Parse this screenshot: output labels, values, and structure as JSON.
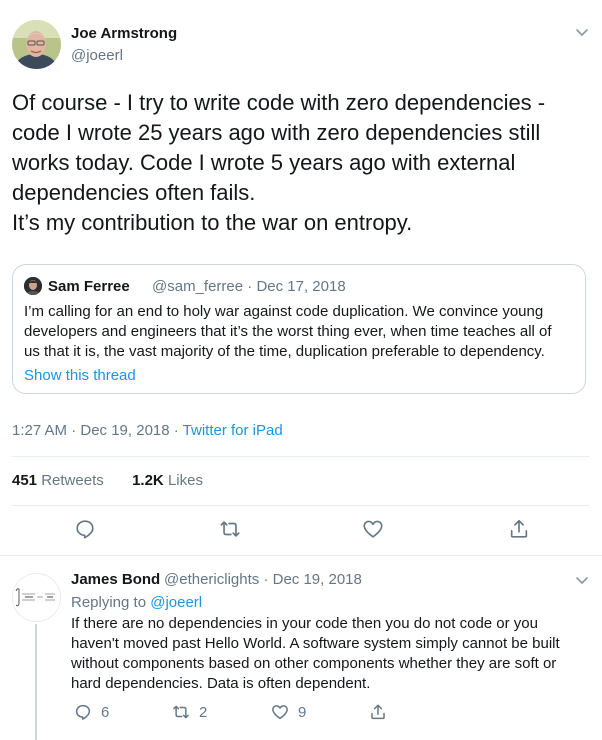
{
  "main_tweet": {
    "author_name": "Joe Armstrong",
    "author_handle": "@joeerl",
    "text_lines": [
      "Of course - I try to write code with zero dependencies -",
      "code I wrote 25 years ago with zero dependencies still",
      "works today. Code I wrote 5 years ago with external",
      "dependencies often fails.",
      "It’s my contribution to the war on entropy."
    ],
    "quoted": {
      "name": "Sam Ferree",
      "handle": "@sam_ferree",
      "separator": " · ",
      "date": "Dec 17, 2018",
      "text_lines": [
        "I’m calling for an end to holy war against code duplication. We convince young",
        "developers and engineers that it’s the worst thing ever, when time teaches all of",
        "us that it is, the vast majority of the time, duplication preferable to dependency."
      ],
      "show_thread": "Show this thread"
    },
    "timestamp": "1:27 AM · Dec 19, 2018",
    "separator": " · ",
    "source": "Twitter for iPad",
    "retweets_count": "451",
    "retweets_label": "Retweets",
    "likes_count": "1.2K",
    "likes_label": "Likes",
    "icons": [
      "reply-icon",
      "retweet-icon",
      "like-icon",
      "share-icon",
      "chevron-down-icon"
    ]
  },
  "reply_tweet": {
    "author_name": "James Bond",
    "author_handle": "@ethericlights",
    "separator": " · ",
    "date": "Dec 19, 2018",
    "replying_to_label": "Replying to ",
    "replying_to_handle": "@joeerl",
    "text_lines": [
      "If there are no dependencies in your code then you do not code or you",
      "haven't moved past Hello World. A software system simply cannot be built",
      "without components based on other components whether they are soft or",
      "hard dependencies. Data is often dependent."
    ],
    "reply_count": "6",
    "retweet_count": "2",
    "like_count": "9"
  },
  "colors": {
    "text": "#14171a",
    "muted": "#657786",
    "link": "#1b95e0",
    "border": "#e6ecf0"
  }
}
